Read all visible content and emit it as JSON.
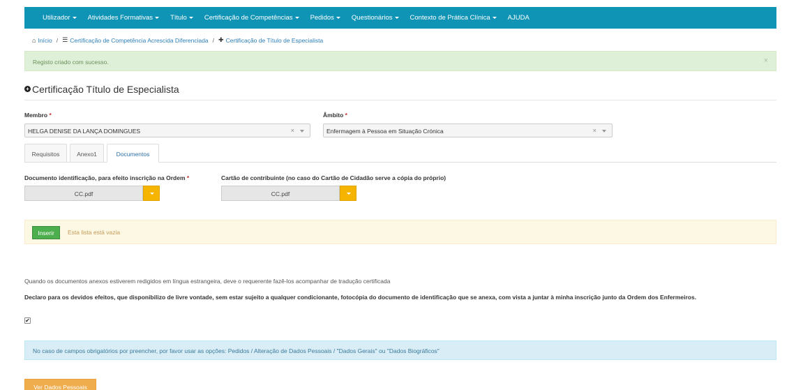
{
  "nav": {
    "items": [
      {
        "label": "Utilizador",
        "dropdown": true
      },
      {
        "label": "Atividades Formativas",
        "dropdown": true
      },
      {
        "label": "Título",
        "dropdown": true
      },
      {
        "label": "Certificação de Competências",
        "dropdown": true
      },
      {
        "label": "Pedidos",
        "dropdown": true
      },
      {
        "label": "Questionários",
        "dropdown": true
      },
      {
        "label": "Contexto de Prática Clínica",
        "dropdown": true
      },
      {
        "label": "AJUDA",
        "dropdown": false
      }
    ],
    "color": "#0f94b6"
  },
  "breadcrumb": {
    "home": "Início",
    "sep": "/",
    "level1": "Certificação de Competência Acrescida Diferenciada",
    "level2": "Certificação de Título de Especialista"
  },
  "alert": {
    "message": "Registo criado com sucesso.",
    "close": "×"
  },
  "form": {
    "title": "Certificação Título de Especialista",
    "membro": {
      "label": "Membro",
      "value": "HELGA DENISE DA LANÇA DOMINGUES"
    },
    "ambito": {
      "label": "Âmbito",
      "value": "Enfermagem à Pessoa em Situação Crónica"
    },
    "required_mark": "*",
    "clear_glyph": "×"
  },
  "tabs": [
    {
      "label": "Requisitos",
      "active": false
    },
    {
      "label": "Anexo1",
      "active": false
    },
    {
      "label": "Documentos",
      "active": true
    }
  ],
  "documents": {
    "doc_id": {
      "label": "Documento identificação, para efeito inscrição na Ordem",
      "file": "CC.pdf"
    },
    "contribuinte": {
      "label": "Cartão de contribuinte (no caso do Cartão de Cidadão serve a cópia do próprio)",
      "file": "CC.pdf"
    }
  },
  "list": {
    "insert_button": "Inserir",
    "empty_text": "Esta lista está vazia"
  },
  "notes": {
    "translation": "Quando os documentos anexos estiverem redigidos em língua estrangeira, deve o requerente fazê-los acompanhar de tradução certificada",
    "declaration": "Declaro para os devidos efeitos, que disponibilizo de livre vontade, sem estar sujeito a qualquer condicionante, fotocópia do documento de identificação que se anexa, com vista a juntar à minha inscrição junto da Ordem dos Enfermeiros.",
    "declaration_checked": true,
    "check_glyph": "✔"
  },
  "info": {
    "message": "No caso de campos obrigatórios por preencher, por favor usar as opções: Pedidos / Alteração de Dados Pessoais / \"Dados Gerais\" ou \"Dados Biográficos\""
  },
  "footer": {
    "button": "Ver Dados Pessoais"
  }
}
